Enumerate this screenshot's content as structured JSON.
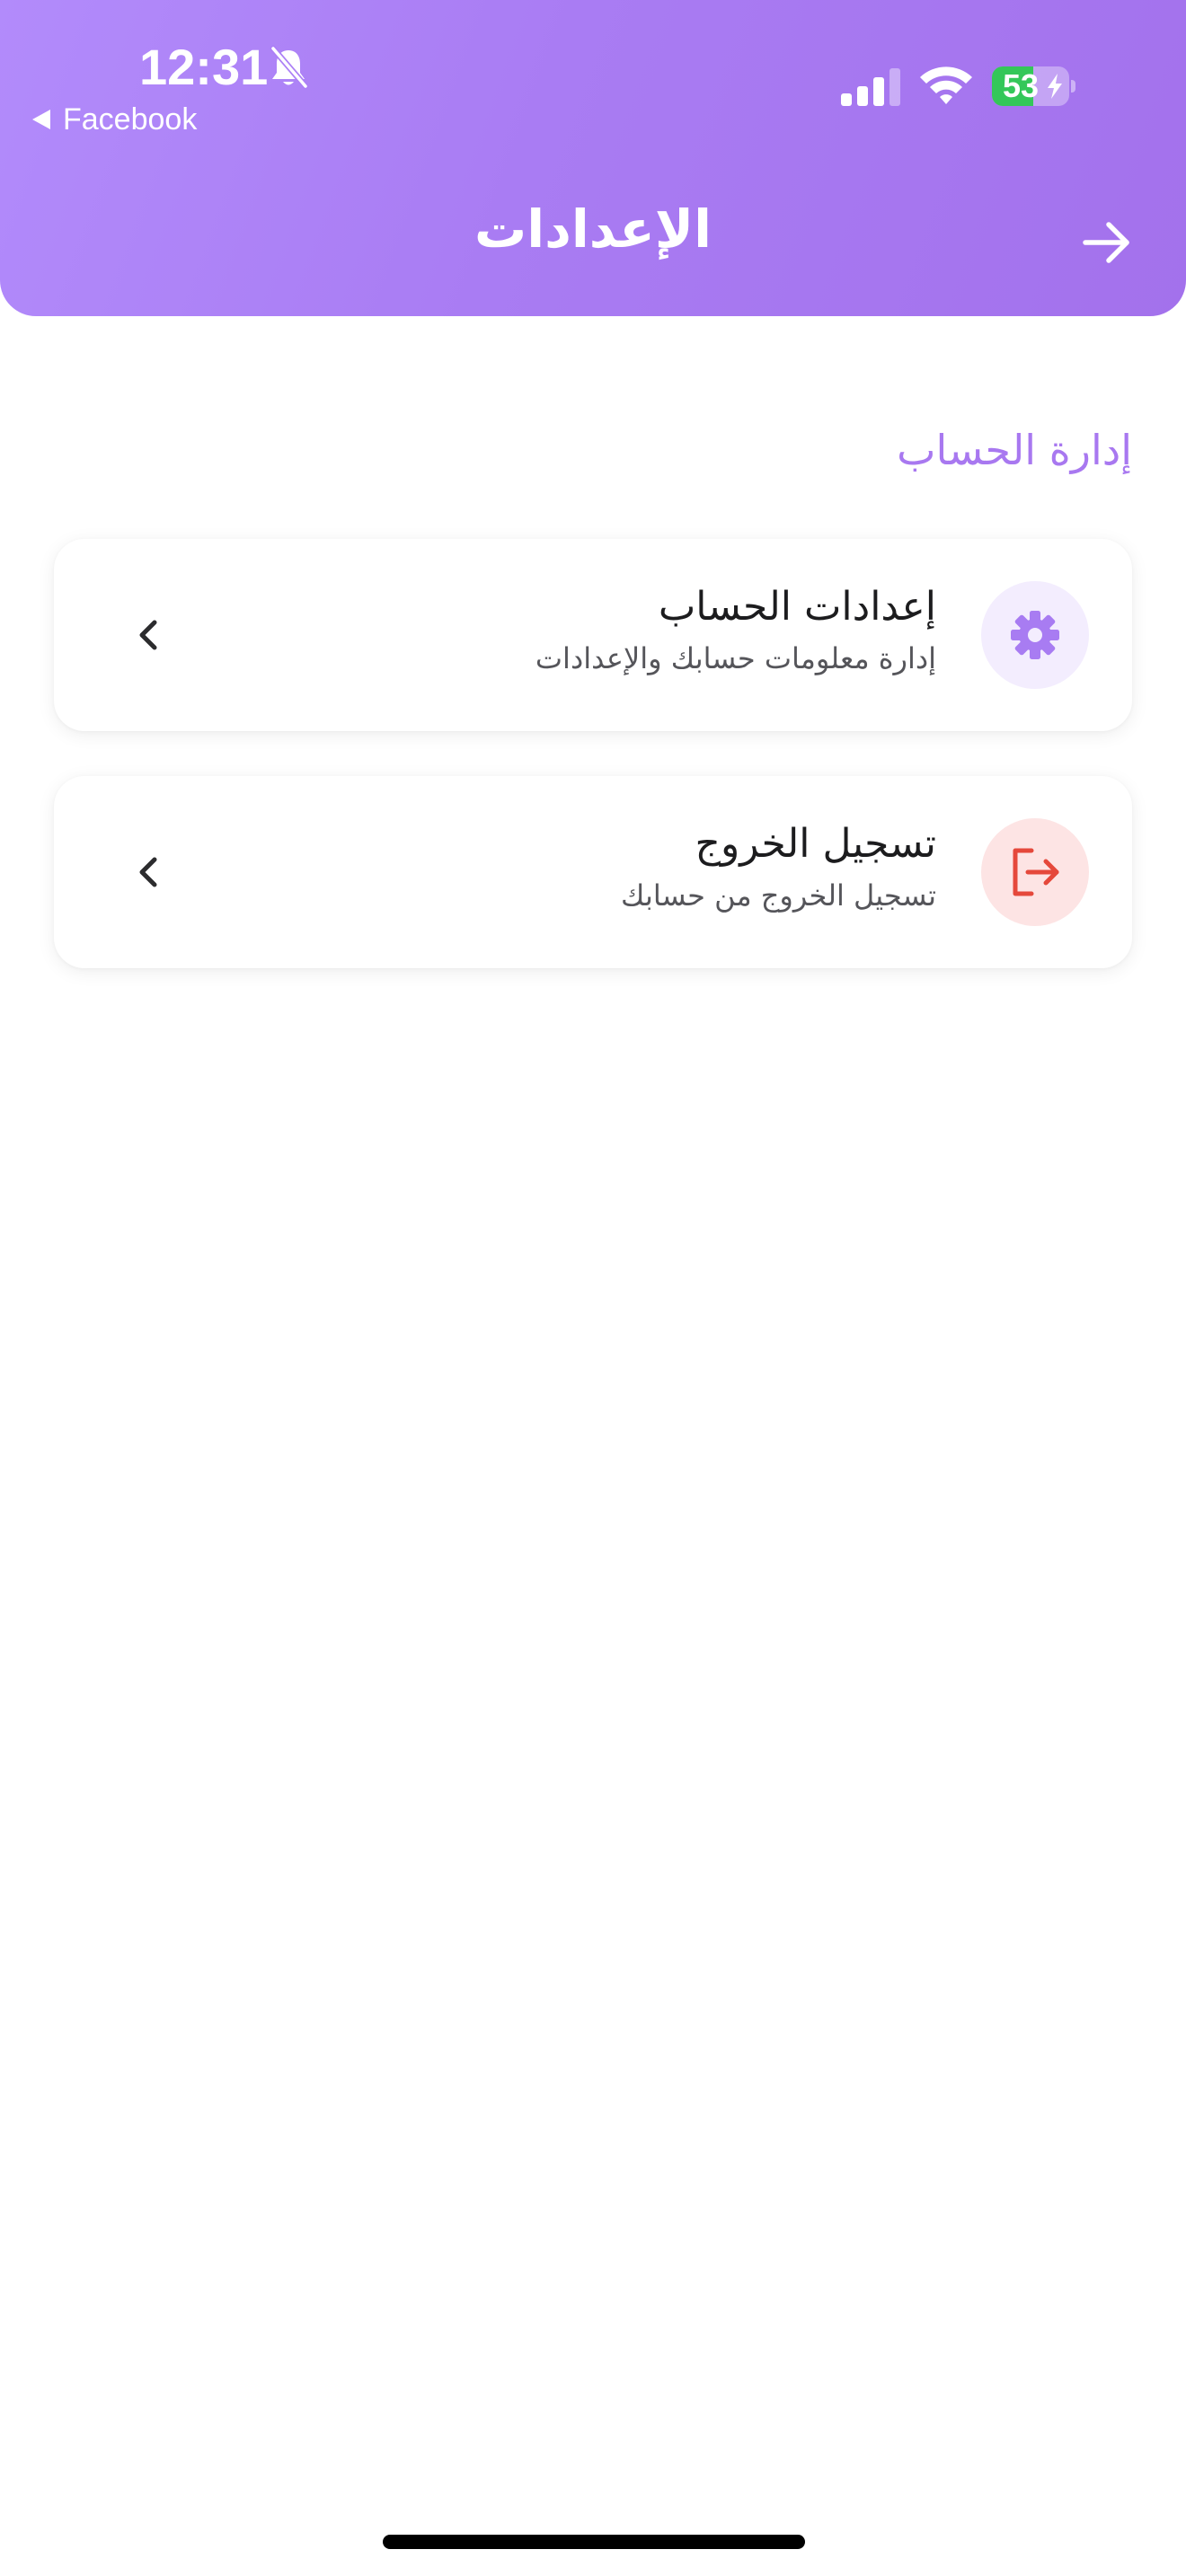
{
  "status_bar": {
    "time": "12:31",
    "back_app_label": "Facebook",
    "battery_percent": "53",
    "battery_level": 0.53,
    "bell_icon": "bell-slash-icon",
    "signal_icon": "cellular-signal-icon",
    "wifi_icon": "wifi-icon",
    "charging_icon": "bolt-icon"
  },
  "header": {
    "title": "الإعدادات",
    "back_icon": "arrow-right-icon",
    "gradient_colors": [
      "#b28bfb",
      "#a371ec"
    ]
  },
  "section": {
    "title": "إدارة الحساب",
    "color": "#a878f0"
  },
  "menu_items": [
    {
      "title": "إعدادات الحساب",
      "subtitle": "إدارة معلومات حسابك والإعدادات",
      "icon": "gear-icon",
      "icon_color": "#a87cf2",
      "icon_bg": "#f3edfe",
      "chevron_icon": "chevron-left-icon"
    },
    {
      "title": "تسجيل الخروج",
      "subtitle": "تسجيل الخروج من حسابك",
      "icon": "logout-icon",
      "icon_color": "#e5483b",
      "icon_bg": "#fde4e4",
      "chevron_icon": "chevron-left-icon"
    }
  ]
}
